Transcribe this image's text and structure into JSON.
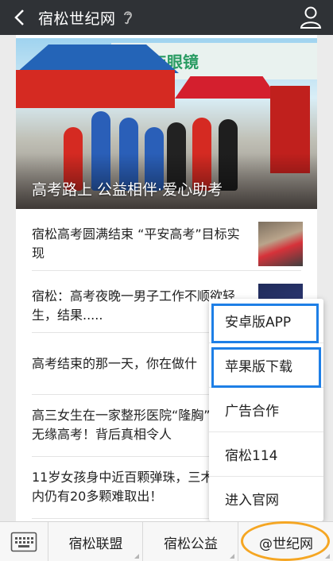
{
  "header": {
    "title": "宿松世纪网"
  },
  "hero": {
    "store_sign": "小年眼镜",
    "caption": "高考路上 公益相伴·爱心助考"
  },
  "articles": [
    {
      "title": "宿松高考圆满结束 “平安高考”目标实现"
    },
    {
      "title": "宿松：高考夜晚一男子工作不顺欲轻生，结果....."
    },
    {
      "title": "高考结束的那一天，你在做什"
    },
    {
      "title": "高三女生在一家整形医院“隆胸”结果无缘高考！背后真相令人"
    },
    {
      "title": "11岁女孩身中近百颗弹珠，三术后体内仍有20多颗难取出！"
    }
  ],
  "popup_menu": {
    "items": [
      "安卓版APP",
      "苹果版下载",
      "广告合作",
      "宿松114",
      "进入官网"
    ]
  },
  "tabbar": {
    "tabs": [
      "宿松联盟",
      "宿松公益",
      "@世纪网"
    ]
  },
  "colors": {
    "header_bg": "#2f3236",
    "highlight_box": "#1e7fe6",
    "highlight_oval": "#f5a623"
  }
}
